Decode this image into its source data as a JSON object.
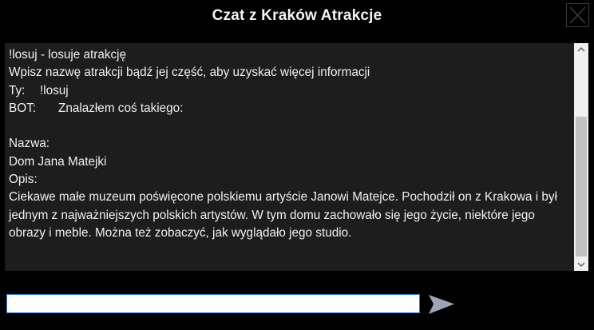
{
  "window": {
    "title": "Czat z Kraków Atrakcje"
  },
  "chat": {
    "lines": [
      "!losuj - losuje atrakcję",
      "Wpisz nazwę atrakcji bądź jej część, aby uzyskać więcej informacji",
      "Ty:",
      "!losuj",
      "BOT:",
      "Znalazłem coś takiego:",
      "Nazwa:",
      "Dom Jana Matejki",
      "Opis:",
      "Ciekawe małe muzeum poświęcone polskiemu artyście Janowi Matejce. Pochodził on z Krakowa i był jednym z najważniejszych polskich artystów. W tym domu zachowało się jego życie, niektóre jego obrazy i meble. Można też zobaczyć, jak wyglądało jego studio."
    ]
  },
  "input": {
    "value": "",
    "placeholder": ""
  },
  "icons": {
    "close": "close-icon",
    "send": "send-arrow-icon",
    "scroll_up": "chevron-up-icon",
    "scroll_down": "chevron-down-icon"
  },
  "colors": {
    "background": "#000000",
    "chat_background": "#1d1d1d",
    "text": "#f0f0f0",
    "input_border": "#2b7ad4",
    "send_arrow": "#9ea3b8",
    "close_border": "#3c3c3c"
  }
}
